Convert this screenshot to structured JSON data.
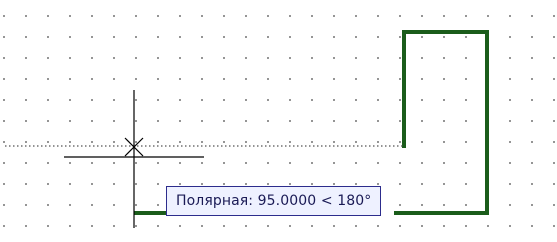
{
  "tracking_tooltip": {
    "text": "Полярная: 95.0000 < 180°"
  },
  "colors": {
    "background": "#ffffff",
    "grid_dot": "#4a4a4a",
    "polyline": "#1a5c1a",
    "crosshair": "#000000",
    "tracking_line": "#555555",
    "tooltip_background": "#eef1ff",
    "tooltip_border": "#2c2c8c",
    "tooltip_text": "#1a1a55"
  },
  "icons": {
    "cursor": "crosshair-aperture-icon"
  }
}
